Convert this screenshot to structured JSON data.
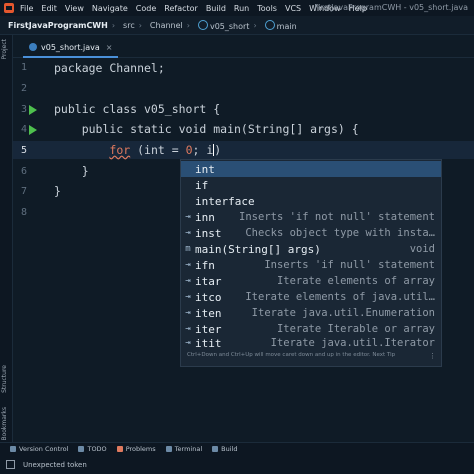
{
  "menubar": {
    "items": [
      "File",
      "Edit",
      "View",
      "Navigate",
      "Code",
      "Refactor",
      "Build",
      "Run",
      "Tools",
      "VCS",
      "Window",
      "Help"
    ],
    "window_title": "FirstJavaProgramCWH - v05_short.java"
  },
  "navbar": {
    "crumbs": [
      "FirstJavaProgramCWH",
      "src",
      "Channel",
      "v05_short",
      "main"
    ]
  },
  "left_tools": {
    "project": "Project",
    "structure": "Structure",
    "bookmarks": "Bookmarks"
  },
  "tab": {
    "label": "v05_short.java",
    "close": "×"
  },
  "editor": {
    "line_numbers": [
      "1",
      "2",
      "3",
      "4",
      "5",
      "6",
      "7",
      "8"
    ],
    "lines": {
      "l1": "package Channel;",
      "l3": "public class v05_short {",
      "l4": "    public static void main(String[] args) {",
      "l5_indent": "        ",
      "l5_for": "for",
      "l5_a": " (int = ",
      "l5_zero": "0",
      "l5_b": "; i",
      "l5_c": ")",
      "l6": "    }",
      "l7": "}"
    }
  },
  "completion": {
    "items": [
      {
        "icon": "",
        "name": "int",
        "desc": ""
      },
      {
        "icon": "",
        "name": "if",
        "desc": ""
      },
      {
        "icon": "",
        "name": "interface",
        "desc": ""
      },
      {
        "icon": "⇥",
        "name": "inn",
        "desc": "Inserts 'if not null' statement"
      },
      {
        "icon": "⇥",
        "name": "inst",
        "desc": "Checks object type with insta…"
      },
      {
        "icon": "m",
        "name": "main(String[] args)",
        "desc": "void"
      },
      {
        "icon": "⇥",
        "name": "ifn",
        "desc": "Inserts 'if null' statement"
      },
      {
        "icon": "⇥",
        "name": "itar",
        "desc": "Iterate elements of array"
      },
      {
        "icon": "⇥",
        "name": "itco",
        "desc": "Iterate elements of java.util…"
      },
      {
        "icon": "⇥",
        "name": "iten",
        "desc": "Iterate java.util.Enumeration"
      },
      {
        "icon": "⇥",
        "name": "iter",
        "desc": "Iterate Iterable or array"
      },
      {
        "icon": "⇥",
        "name": "itit",
        "desc": "Iterate java.util.Iterator"
      }
    ],
    "hint": "Ctrl+Down and Ctrl+Up will move caret down and up in the editor. Next Tip",
    "more": "⋮"
  },
  "toolwindows": [
    "Version Control",
    "TODO",
    "Problems",
    "Terminal",
    "Build"
  ],
  "status": {
    "message": "Unexpected token"
  },
  "colors": {
    "accent": "#4a90d9",
    "keyword_error": "#e07a5f",
    "run_icon": "#4ec04e",
    "selection": "#2a4f75"
  }
}
